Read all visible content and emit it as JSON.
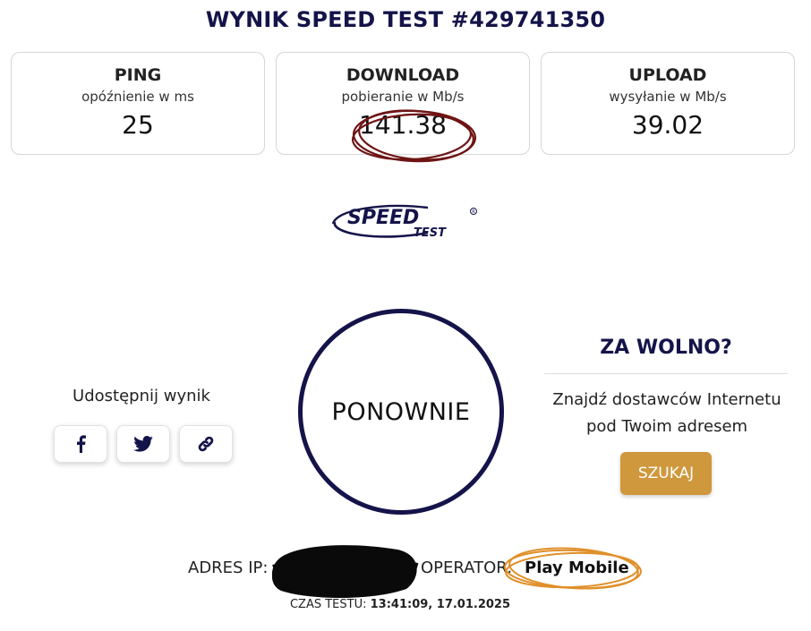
{
  "title": "WYNIK SPEED TEST #429741350",
  "metrics": {
    "ping": {
      "label": "PING",
      "sub": "opóźnienie w ms",
      "value": "25"
    },
    "download": {
      "label": "DOWNLOAD",
      "sub": "pobieranie w Mb/s",
      "value": "141.38"
    },
    "upload": {
      "label": "UPLOAD",
      "sub": "wysyłanie w Mb/s",
      "value": "39.02"
    }
  },
  "logo": {
    "main": "SPEED",
    "secondary": "TEST"
  },
  "share": {
    "label": "Udostępnij wynik"
  },
  "again_button": "PONOWNIE",
  "too_slow": {
    "title": "ZA WOLNO?",
    "text_line1": "Znajdź dostawców Internetu",
    "text_line2": "pod Twoim adresem",
    "button": "SZUKAJ"
  },
  "connection": {
    "ip_label": "ADRES IP:",
    "operator_label": "OPERATOR:",
    "operator_value": "Play Mobile"
  },
  "test_time": {
    "label": "CZAS TESTU:",
    "value": "13:41:09, 17.01.2025"
  },
  "colors": {
    "navy": "#14144a",
    "accent": "#d0983c",
    "download_mark": "#6e1414",
    "operator_mark": "#e0902a"
  }
}
